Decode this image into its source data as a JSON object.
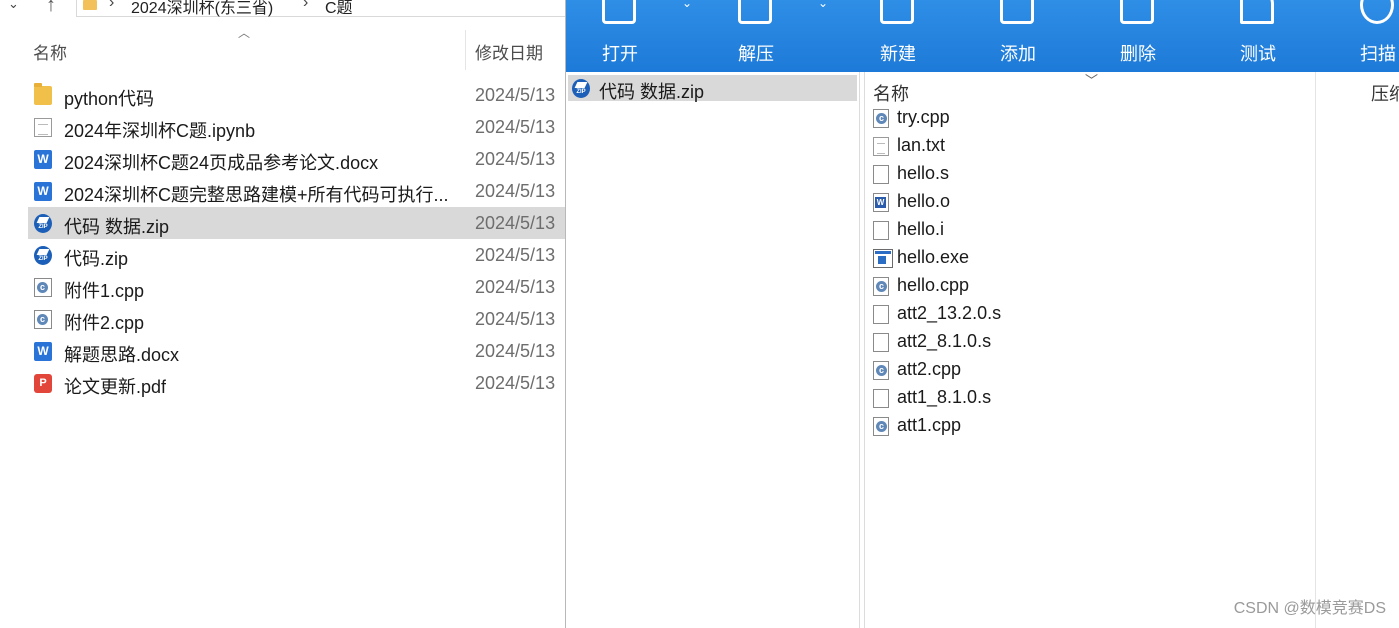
{
  "explorer": {
    "breadcrumb": [
      "2024深圳杯(东三省)",
      "C题"
    ],
    "columns": {
      "name": "名称",
      "date_modified": "修改日期"
    },
    "files": [
      {
        "name": "python代码",
        "date": "2024/5/13",
        "icon": "folder-icon"
      },
      {
        "name": "2024年深圳杯C题.ipynb",
        "date": "2024/5/13",
        "icon": "document-icon"
      },
      {
        "name": "2024深圳杯C题24页成品参考论文.docx",
        "date": "2024/5/13",
        "icon": "word-icon"
      },
      {
        "name": "2024深圳杯C题完整思路建模+所有代码可执行...",
        "date": "2024/5/13",
        "icon": "word-icon"
      },
      {
        "name": "代码 数据.zip",
        "date": "2024/5/13",
        "icon": "zip-icon",
        "selected": true
      },
      {
        "name": "代码.zip",
        "date": "2024/5/13",
        "icon": "zip-icon"
      },
      {
        "name": "附件1.cpp",
        "date": "2024/5/13",
        "icon": "cpp-icon"
      },
      {
        "name": "附件2.cpp",
        "date": "2024/5/13",
        "icon": "cpp-icon"
      },
      {
        "name": "解题思路.docx",
        "date": "2024/5/13",
        "icon": "word-icon"
      },
      {
        "name": "论文更新.pdf",
        "date": "2024/5/13",
        "icon": "pdf-icon"
      }
    ]
  },
  "archive": {
    "toolbar": [
      "打开",
      "解压",
      "新建",
      "添加",
      "删除",
      "测试",
      "扫描"
    ],
    "tree_item": "代码 数据.zip",
    "columns": {
      "name": "名称",
      "size": "压缩"
    },
    "files": [
      {
        "name": "try.cpp",
        "icon": "cpp-icon"
      },
      {
        "name": "lan.txt",
        "icon": "text-icon"
      },
      {
        "name": "hello.s",
        "icon": "blank-file-icon"
      },
      {
        "name": "hello.o",
        "icon": "object-file-icon"
      },
      {
        "name": "hello.i",
        "icon": "blank-file-icon"
      },
      {
        "name": "hello.exe",
        "icon": "exe-icon"
      },
      {
        "name": "hello.cpp",
        "icon": "cpp-icon"
      },
      {
        "name": "att2_13.2.0.s",
        "icon": "blank-file-icon"
      },
      {
        "name": "att2_8.1.0.s",
        "icon": "blank-file-icon"
      },
      {
        "name": "att2.cpp",
        "icon": "cpp-icon"
      },
      {
        "name": "att1_8.1.0.s",
        "icon": "blank-file-icon"
      },
      {
        "name": "att1.cpp",
        "icon": "cpp-icon"
      }
    ]
  },
  "watermark": "CSDN @数模竞赛DS"
}
